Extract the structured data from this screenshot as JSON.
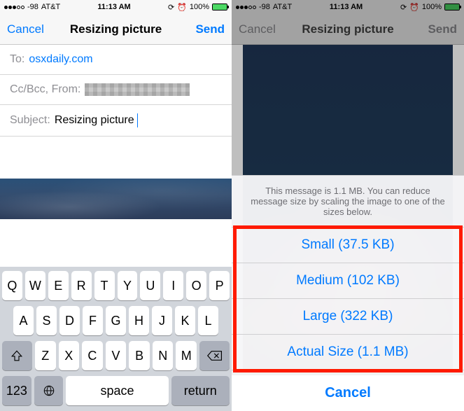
{
  "status": {
    "signal": "-98",
    "carrier": "AT&T",
    "time": "11:13 AM",
    "battery_pct": "100%"
  },
  "left": {
    "nav": {
      "cancel": "Cancel",
      "title": "Resizing picture",
      "send": "Send"
    },
    "to_label": "To:",
    "to_value": "osxdaily.com",
    "ccbcc_label": "Cc/Bcc, From:",
    "subject_label": "Subject:",
    "subject_value": "Resizing picture",
    "keyboard": {
      "row1": [
        "Q",
        "W",
        "E",
        "R",
        "T",
        "Y",
        "U",
        "I",
        "O",
        "P"
      ],
      "row2": [
        "A",
        "S",
        "D",
        "F",
        "G",
        "H",
        "J",
        "K",
        "L"
      ],
      "row3": [
        "Z",
        "X",
        "C",
        "V",
        "B",
        "N",
        "M"
      ],
      "num": "123",
      "space": "space",
      "retn": "return"
    }
  },
  "right": {
    "nav": {
      "cancel": "Cancel",
      "title": "Resizing picture",
      "send": "Send"
    },
    "sheet": {
      "message": "This message is 1.1 MB. You can reduce message size by scaling the image to one of the sizes below.",
      "small": "Small (37.5 KB)",
      "medium": "Medium (102 KB)",
      "large": "Large (322 KB)",
      "actual": "Actual Size (1.1 MB)",
      "cancel": "Cancel"
    }
  }
}
